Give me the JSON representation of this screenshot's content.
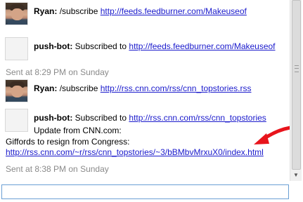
{
  "messages": [
    {
      "sender": "Ryan:",
      "text": "/subscribe",
      "link": "http://feeds.feedburner.com/Makeuseof"
    },
    {
      "sender": "push-bot:",
      "text": "Subscribed to",
      "link": "http://feeds.feedburner.com/Makeuseof"
    },
    {
      "sender": "Ryan:",
      "text": "/subscribe",
      "link": "http://rss.cnn.com/rss/cnn_topstories.rss"
    },
    {
      "sender": "push-bot:",
      "text": "Subscribed to",
      "link": "http://rss.cnn.com/rss/cnn_topstories",
      "update_line": "Update from CNN.com:",
      "headline": "Giffords to resign from Congress:",
      "update_link": "http://rss.cnn.com/~r/rss/cnn_topstories/~3/bBMbvMrxuX0/index.html"
    }
  ],
  "timestamps": [
    "Sent at 8:29 PM on Sunday",
    "Sent at 8:38 PM on Sunday"
  ],
  "annotation": {
    "arrow_color": "#e8141c"
  },
  "compose": {
    "value": "",
    "placeholder": ""
  },
  "colors": {
    "link": "#1a1acc",
    "meta": "#8a8a8a",
    "input_border": "#6a9fd4"
  }
}
